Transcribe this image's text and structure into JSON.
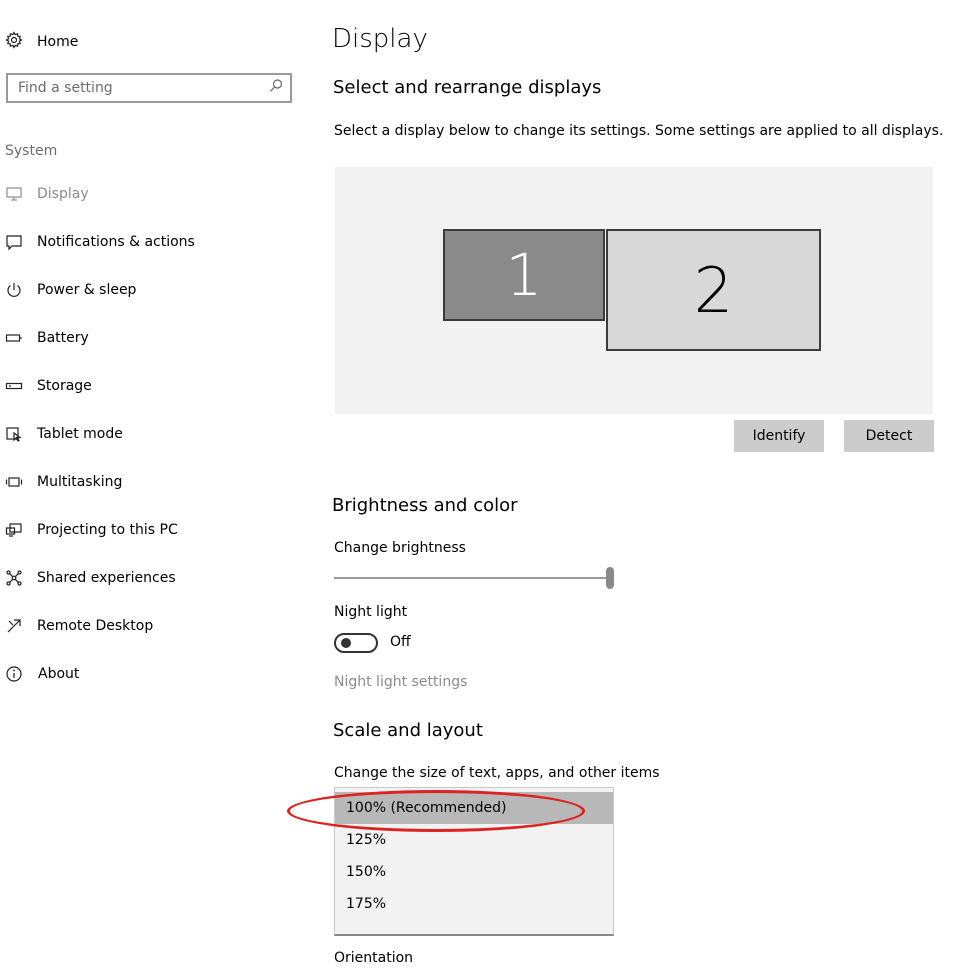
{
  "sidebar": {
    "home_label": "Home",
    "search_placeholder": "Find a setting",
    "section_label": "System",
    "items": [
      {
        "label": "Display",
        "icon": "monitor-icon",
        "active": true
      },
      {
        "label": "Notifications & actions",
        "icon": "notification-icon"
      },
      {
        "label": "Power & sleep",
        "icon": "power-icon"
      },
      {
        "label": "Battery",
        "icon": "battery-icon"
      },
      {
        "label": "Storage",
        "icon": "storage-icon"
      },
      {
        "label": "Tablet mode",
        "icon": "tablet-mode-icon"
      },
      {
        "label": "Multitasking",
        "icon": "multitasking-icon"
      },
      {
        "label": "Projecting to this PC",
        "icon": "projecting-icon"
      },
      {
        "label": "Shared experiences",
        "icon": "shared-experiences-icon"
      },
      {
        "label": "Remote Desktop",
        "icon": "remote-desktop-icon"
      },
      {
        "label": "About",
        "icon": "info-icon"
      }
    ]
  },
  "main": {
    "title": "Display",
    "arrange": {
      "heading": "Select and rearrange displays",
      "description": "Select a display below to change its settings. Some settings are applied to all displays.",
      "monitor1_label": "1",
      "monitor2_label": "2",
      "identify_label": "Identify",
      "detect_label": "Detect"
    },
    "brightness": {
      "heading": "Brightness and color",
      "brightness_label": "Change brightness",
      "brightness_level_percent": 100,
      "night_light_label": "Night light",
      "night_light_state": "Off",
      "night_light_settings_link": "Night light settings"
    },
    "scale": {
      "heading": "Scale and layout",
      "size_label": "Change the size of text, apps, and other items",
      "options": [
        "100% (Recommended)",
        "125%",
        "150%",
        "175%"
      ],
      "selected_index": 0,
      "orientation_label": "Orientation"
    }
  },
  "colors": {
    "annotation": "#d22222",
    "selected_option_bg": "#b8b8b8",
    "button_bg": "#cccccc",
    "disabled_text": "#8c8c8c"
  }
}
